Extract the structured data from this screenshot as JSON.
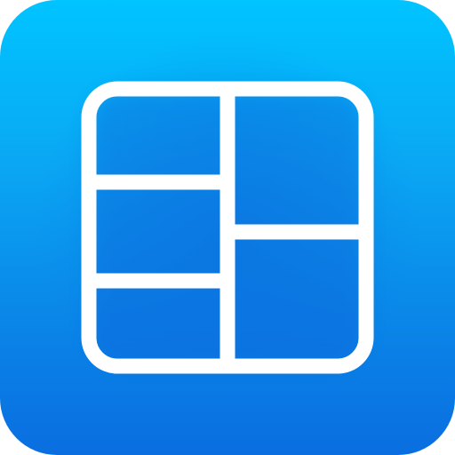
{
  "app_icon": {
    "icon": "photo-collage-grid-icon",
    "colors": {
      "gradient_top": "#00c4ff",
      "gradient_bottom": "#0a6ee0",
      "glyph": "#ffffff"
    }
  }
}
